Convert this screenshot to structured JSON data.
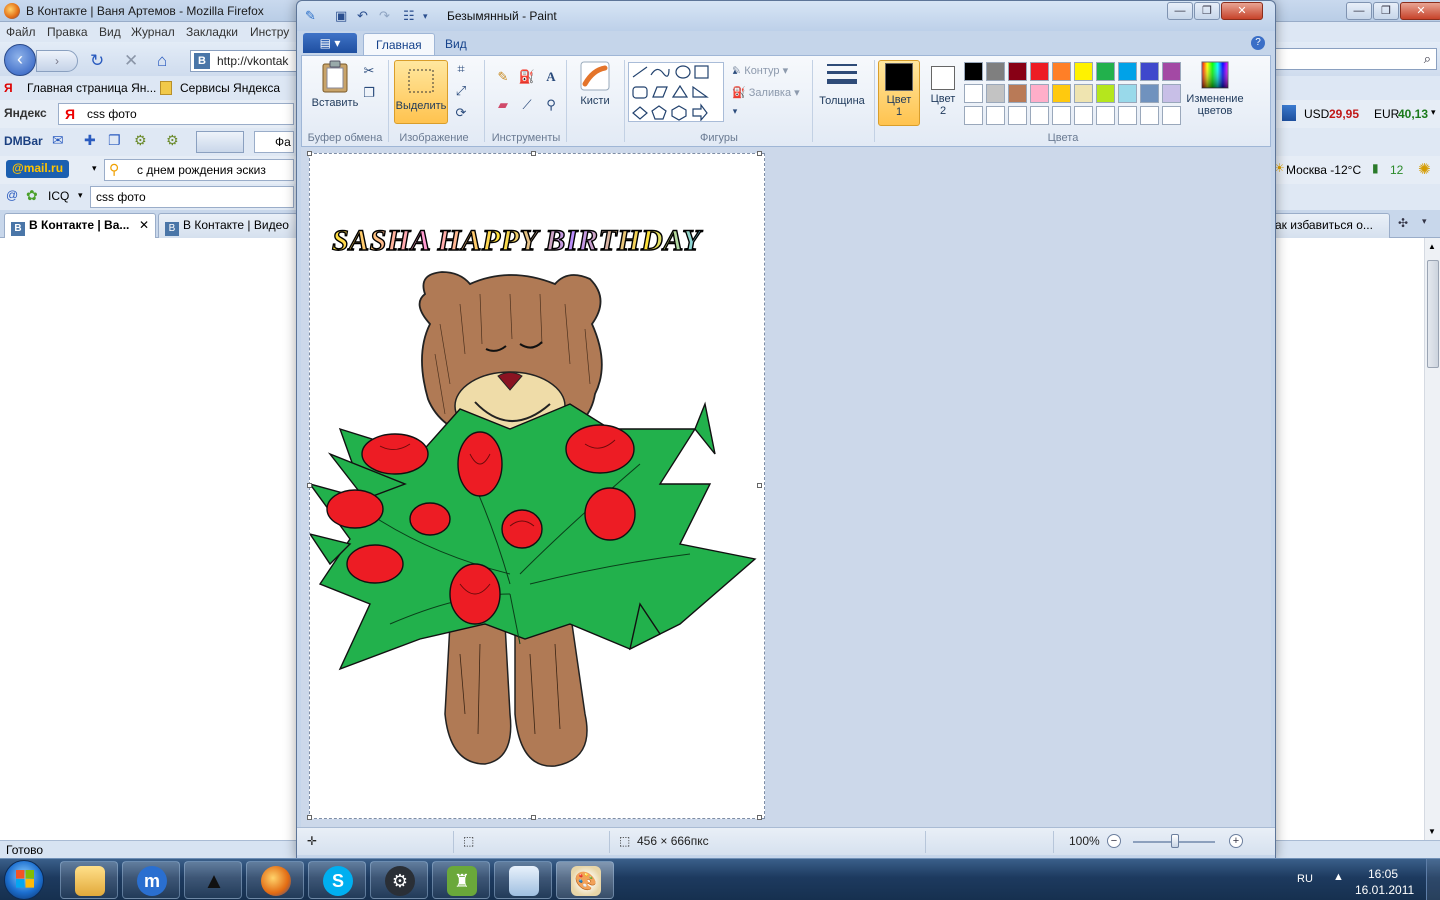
{
  "firefox": {
    "title": "В Контакте | Ваня Артемов - Mozilla Firefox",
    "menu": [
      "Файл",
      "Правка",
      "Вид",
      "Журнал",
      "Закладки",
      "Инстру"
    ],
    "url": "http://vkontak",
    "bookmarks": [
      "Главная страница Ян...",
      "Сервисы Яндекса"
    ],
    "yandex": {
      "label": "Яндекс",
      "query": "css фото"
    },
    "dmbar": {
      "label": "DMBar",
      "partial": "Фа"
    },
    "mail": {
      "label": "@mail.ru",
      "query": "с днем рождения эскиз"
    },
    "icq": {
      "label": "ICQ",
      "query": "css фото"
    },
    "currency": {
      "usd_label": "USD",
      "usd_value": "29,95",
      "eur_label": "EUR",
      "eur_value": "40,13"
    },
    "weather": {
      "text": "Москва -12°C",
      "traffic": "12"
    },
    "tabs": [
      {
        "label": "В Контакте | Ва..."
      },
      {
        "label": "В Контакте | Видео"
      },
      {
        "label": "ак избавиться о..."
      }
    ],
    "status": "Готово"
  },
  "paint": {
    "title": "Безымянный - Paint",
    "ribbon_tabs": [
      "Главная",
      "Вид"
    ],
    "groups": {
      "clipboard": {
        "label": "Буфер обмена",
        "paste": "Вставить"
      },
      "image": {
        "label": "Изображение",
        "select": "Выделить"
      },
      "tools": {
        "label": "Инструменты"
      },
      "brushes": {
        "label": "Кисти"
      },
      "shapes": {
        "label": "Фигуры",
        "outline": "Контур",
        "fill": "Заливка"
      },
      "size": {
        "label": "Толщина"
      },
      "colors": {
        "label": "Цвета",
        "color1_a": "Цвет",
        "color1_b": "1",
        "color2_a": "Цвет",
        "color2_b": "2",
        "edit_a": "Изменение",
        "edit_b": "цветов",
        "color1": "#000000",
        "color2": "#ffffff",
        "palette": [
          "#000000",
          "#7f7f7f",
          "#880015",
          "#ed1c24",
          "#ff7f27",
          "#fff200",
          "#22b14c",
          "#00a2e8",
          "#3f48cc",
          "#a349a4",
          "#ffffff",
          "#c3c3c3",
          "#b97a57",
          "#ffaec9",
          "#ffc90e",
          "#efe4b0",
          "#b5e61d",
          "#99d9ea",
          "#7092be",
          "#c8bfe7",
          "#ffffff",
          "#ffffff",
          "#ffffff",
          "#ffffff",
          "#ffffff",
          "#ffffff",
          "#ffffff",
          "#ffffff",
          "#ffffff",
          "#ffffff"
        ]
      }
    },
    "canvas": {
      "heading": "SASHA HAPPY BIRTHDAY"
    },
    "status": {
      "size": "456 × 666пкс",
      "zoom": "100%"
    }
  },
  "taskbar": {
    "lang": "RU",
    "time": "16:05",
    "date": "16.01.2011"
  }
}
